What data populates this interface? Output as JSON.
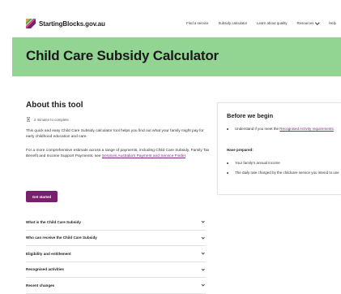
{
  "header": {
    "logo_text": "StartingBlocks.gov.au",
    "nav": [
      {
        "label": "Find a service"
      },
      {
        "label": "Subsidy calculator"
      },
      {
        "label": "Learn about quality"
      },
      {
        "label": "Resources"
      },
      {
        "label": "Help"
      }
    ]
  },
  "banner": {
    "title": "Child Care Subsidy Calculator",
    "color": "#92d593"
  },
  "about": {
    "title": "About this tool",
    "time_icon": "hourglass-icon",
    "time": "2 minutes to complete",
    "p1": "This quick and easy Child Care Subsidy calculator tool helps you find out what your family might pay for early childhood education and care.",
    "p2_start": "For a more comprehensive estimate across a range of payments, including Child Care Subsidy, Family Tax Benefit and Income Support Payments, see ",
    "p2_link": "Services Australia's Payment and Service Finder",
    "p2_end": ".",
    "button": "Get started"
  },
  "accordion": [
    {
      "label": "What is the Child Care Subsidy"
    },
    {
      "label": "Who can receive the Child Care Subsidy"
    },
    {
      "label": "Eligibility and entitlement"
    },
    {
      "label": "Recognised activities"
    },
    {
      "label": "Recent changes"
    }
  ],
  "before": {
    "title": "Before we begin",
    "b1_start": "Understand if you meet the ",
    "b1_link": "Recognised Activity requirements",
    "b1_end": ".",
    "have_prepared": "Have prepared:",
    "b2": "Your family's annual income",
    "b3": "The daily rate charged by the childcare service you intend to use"
  },
  "colors": {
    "accent": "#7a1f6e",
    "link": "#7b2b7e"
  }
}
